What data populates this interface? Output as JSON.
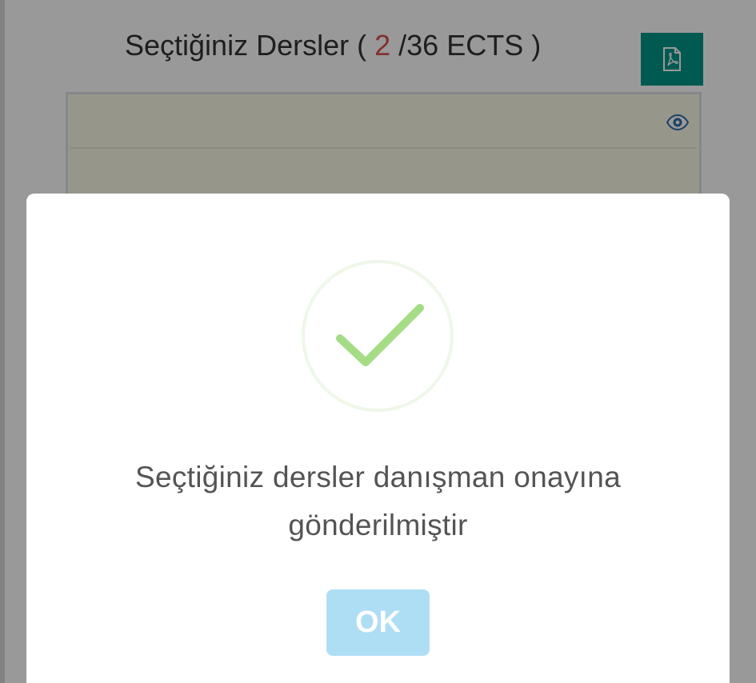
{
  "header": {
    "title_prefix": "Seçtiğiniz Dersler (",
    "ects_selected": "2",
    "title_suffix": "/36 ECTS )",
    "pdf_icon": "pdf-file-icon"
  },
  "course_table": {
    "row_icon": "eye-icon"
  },
  "modal": {
    "icon": "success-check-icon",
    "message_line1": "Seçtiğiniz dersler danışman onayına",
    "message_line2": "gönderilmiştir",
    "ok_label": "OK"
  },
  "colors": {
    "accent": "#009688",
    "success": "#a5dc86",
    "ok_button": "#aedef4",
    "ects_number": "#d9534f"
  }
}
